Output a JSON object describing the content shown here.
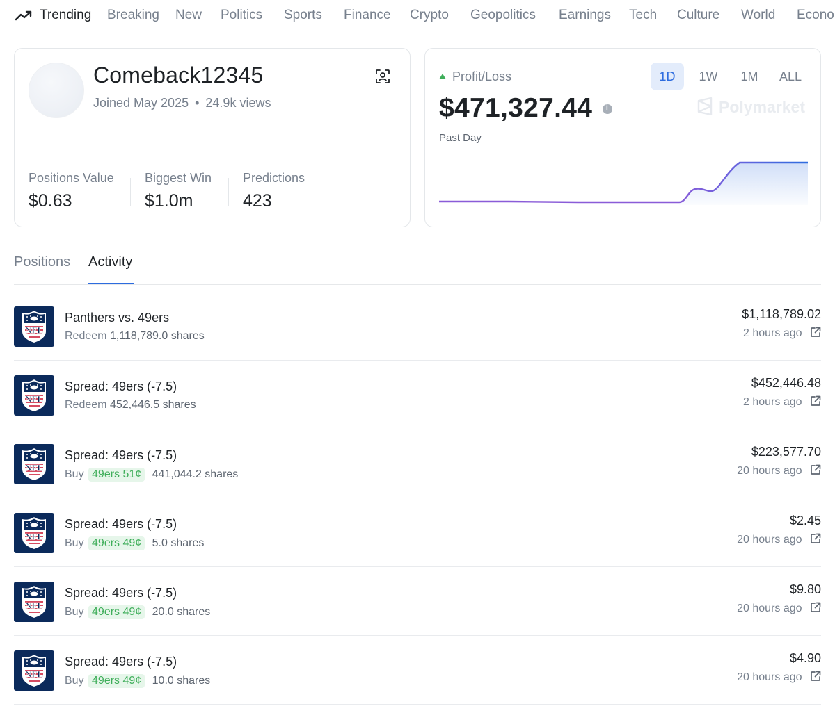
{
  "nav": {
    "items": [
      {
        "label": "Trending",
        "icon": "trending-up-icon"
      },
      {
        "label": "Breaking"
      },
      {
        "label": "New"
      },
      {
        "label": "Politics"
      },
      {
        "label": "Sports"
      },
      {
        "label": "Finance"
      },
      {
        "label": "Crypto"
      },
      {
        "label": "Geopolitics"
      },
      {
        "label": "Earnings"
      },
      {
        "label": "Tech"
      },
      {
        "label": "Culture"
      },
      {
        "label": "World"
      },
      {
        "label": "Econo"
      }
    ]
  },
  "profile": {
    "username": "Comeback12345",
    "joined": "Joined May 2025",
    "views": "24.9k views",
    "stats": [
      {
        "label": "Positions Value",
        "value": "$0.63"
      },
      {
        "label": "Biggest Win",
        "value": "$1.0m"
      },
      {
        "label": "Predictions",
        "value": "423"
      }
    ]
  },
  "pnl": {
    "label": "Profit/Loss",
    "value": "$471,327.44",
    "period_label": "Past Day",
    "ranges": [
      "1D",
      "1W",
      "1M",
      "ALL"
    ],
    "active_range": "1D",
    "brand": "Polymarket",
    "colors": {
      "up": "#3fae5a",
      "line_start": "#8a5cd8",
      "line_end": "#2d6cdf"
    }
  },
  "tabs": {
    "positions": "Positions",
    "activity": "Activity",
    "active": "Activity"
  },
  "activity": [
    {
      "title": "Panthers vs. 49ers",
      "action": "Redeem",
      "badge": "",
      "shares": "1,118,789.0 shares",
      "amount": "$1,118,789.02",
      "time": "2 hours ago"
    },
    {
      "title": "Spread: 49ers (-7.5)",
      "action": "Redeem",
      "badge": "",
      "shares": "452,446.5 shares",
      "amount": "$452,446.48",
      "time": "2 hours ago"
    },
    {
      "title": "Spread: 49ers (-7.5)",
      "action": "Buy",
      "badge": "49ers 51¢",
      "shares": "441,044.2 shares",
      "amount": "$223,577.70",
      "time": "20 hours ago"
    },
    {
      "title": "Spread: 49ers (-7.5)",
      "action": "Buy",
      "badge": "49ers 49¢",
      "shares": "5.0 shares",
      "amount": "$2.45",
      "time": "20 hours ago"
    },
    {
      "title": "Spread: 49ers (-7.5)",
      "action": "Buy",
      "badge": "49ers 49¢",
      "shares": "20.0 shares",
      "amount": "$9.80",
      "time": "20 hours ago"
    },
    {
      "title": "Spread: 49ers (-7.5)",
      "action": "Buy",
      "badge": "49ers 49¢",
      "shares": "10.0 shares",
      "amount": "$4.90",
      "time": "20 hours ago"
    }
  ]
}
